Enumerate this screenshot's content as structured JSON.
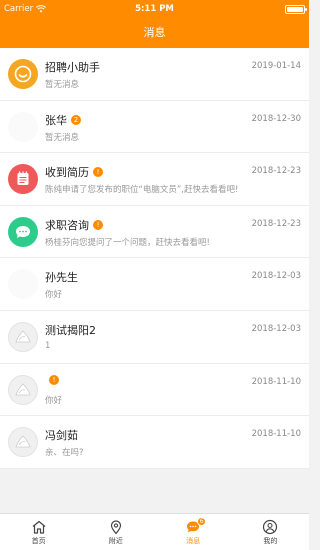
{
  "status_bar": {
    "carrier": "Carrier",
    "time": "5:11 PM"
  },
  "nav": {
    "title": "消息"
  },
  "messages": [
    {
      "name": "招聘小助手",
      "badge": "",
      "preview": "暂无消息",
      "date": "2019-01-14",
      "avatar_icon": "smile-icon"
    },
    {
      "name": "张华",
      "badge": "2",
      "preview": "暂无消息",
      "date": "2018-12-30",
      "avatar_icon": "blank-avatar"
    },
    {
      "name": "收到简历",
      "badge": "!",
      "preview": "陈纯申请了您发布的职位“电脑文员”,赶快去看看吧!",
      "date": "2018-12-23",
      "avatar_icon": "notepad-icon"
    },
    {
      "name": "求职咨询",
      "badge": "!",
      "preview": "杨桂芬向您提问了一个问题，赶快去看看吧!",
      "date": "2018-12-23",
      "avatar_icon": "chat-bubble-icon"
    },
    {
      "name": "孙先生",
      "badge": "",
      "preview": "你好",
      "date": "2018-12-03",
      "avatar_icon": "blank-avatar"
    },
    {
      "name": "测试揭阳2",
      "badge": "",
      "preview": "1",
      "date": "2018-12-03",
      "avatar_icon": "placeholder-avatar"
    },
    {
      "name": "",
      "badge": "!",
      "preview": "你好",
      "date": "2018-11-10",
      "avatar_icon": "placeholder-avatar"
    },
    {
      "name": "冯剑茹",
      "badge": "",
      "preview": "亲、在吗?",
      "date": "2018-11-10",
      "avatar_icon": "placeholder-avatar"
    }
  ],
  "tabs": [
    {
      "label": "首页",
      "icon": "home-icon"
    },
    {
      "label": "附近",
      "icon": "location-pin-icon"
    },
    {
      "label": "消息",
      "icon": "message-icon",
      "badge": "6",
      "active": true
    },
    {
      "label": "我的",
      "icon": "user-icon"
    }
  ],
  "colors": {
    "accent": "#ff8c00"
  }
}
